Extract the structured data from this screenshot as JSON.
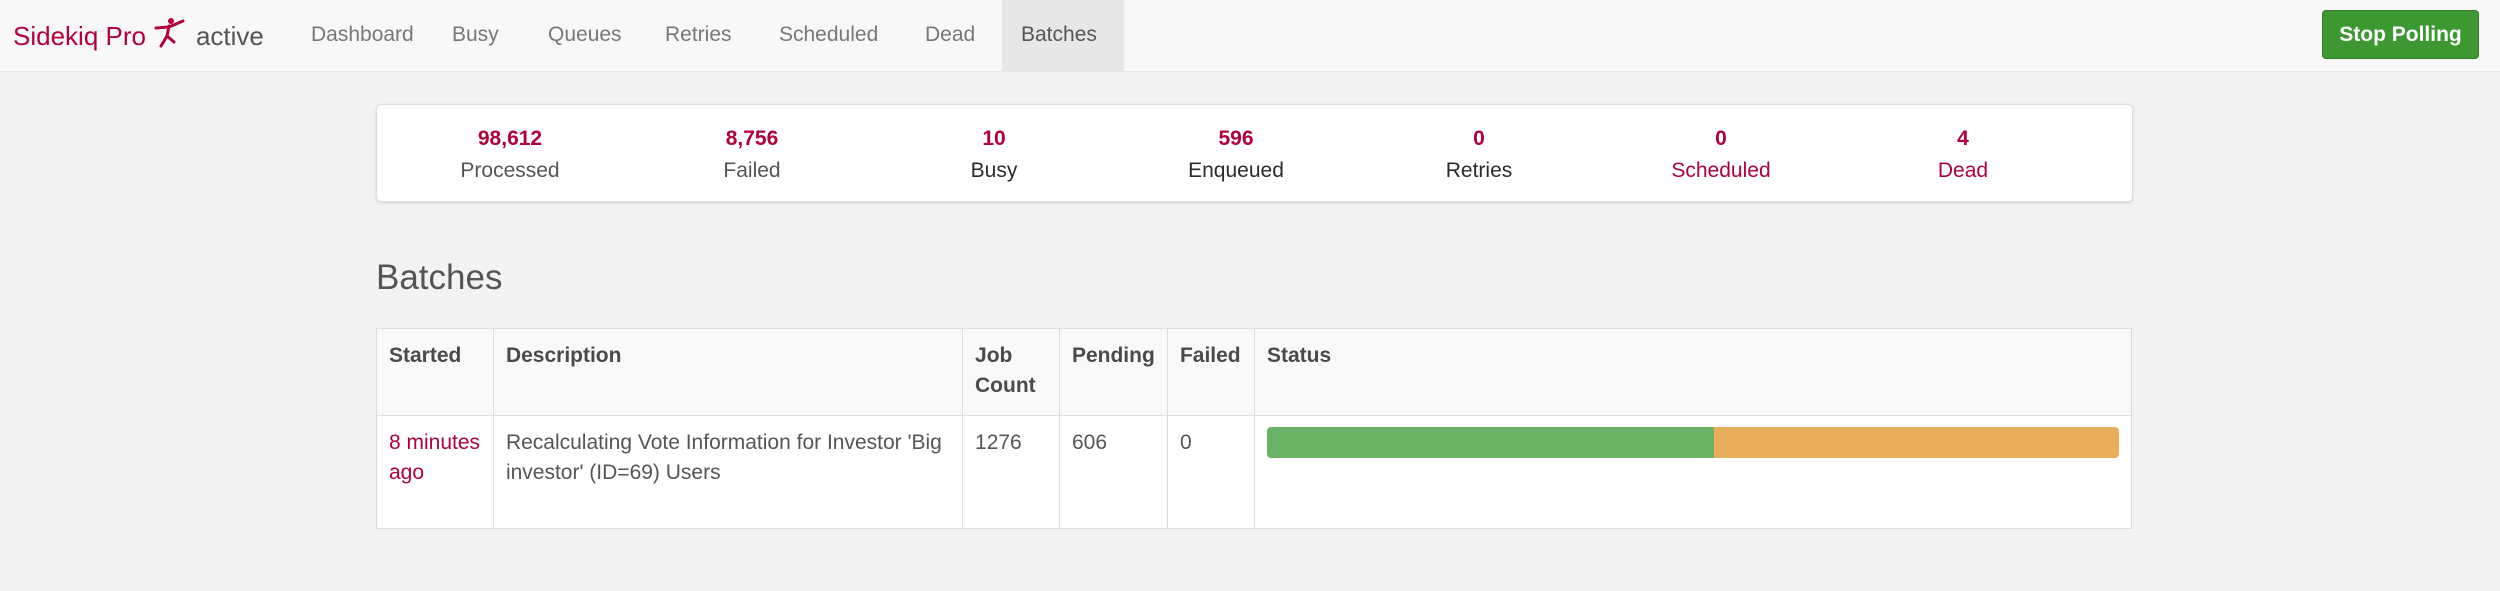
{
  "brand": {
    "name": "Sidekiq Pro",
    "status": "active",
    "logo_icon": "sidekiq-kicker-icon",
    "accent": "#b1003e"
  },
  "nav": {
    "items": [
      {
        "label": "Dashboard"
      },
      {
        "label": "Busy"
      },
      {
        "label": "Queues"
      },
      {
        "label": "Retries"
      },
      {
        "label": "Scheduled"
      },
      {
        "label": "Dead"
      },
      {
        "label": "Batches",
        "active": true
      }
    ],
    "stop_polling_label": "Stop Polling",
    "stop_polling_color": "#3d9832"
  },
  "summary": {
    "processed": {
      "count": "98,612",
      "label": "Processed"
    },
    "failed": {
      "count": "8,756",
      "label": "Failed"
    },
    "busy": {
      "count": "10",
      "label": "Busy"
    },
    "enqueued": {
      "count": "596",
      "label": "Enqueued"
    },
    "retries": {
      "count": "0",
      "label": "Retries"
    },
    "scheduled": {
      "count": "0",
      "label": "Scheduled"
    },
    "dead": {
      "count": "4",
      "label": "Dead"
    }
  },
  "batches": {
    "title": "Batches",
    "columns": [
      "Started",
      "Description",
      "Job Count",
      "Pending",
      "Failed",
      "Status"
    ],
    "rows": [
      {
        "started": "8 minutes ago",
        "description": "Recalculating Vote Information for Investor 'Big investor' (ID=69) Users",
        "job_count": "1276",
        "pending": "606",
        "failed": "0",
        "status": {
          "success_fraction": 0.525,
          "pending_fraction": 0.475,
          "success_color": "#6db365",
          "pending_color": "#e8ae5a"
        }
      }
    ]
  }
}
